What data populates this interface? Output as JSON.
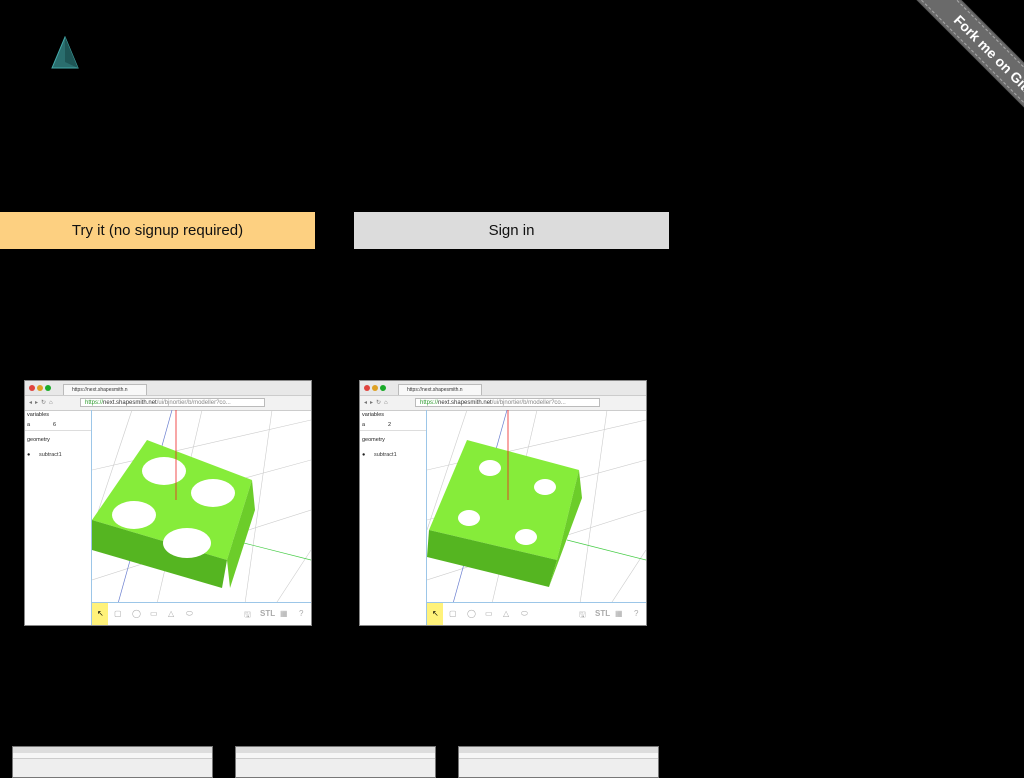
{
  "logo": {
    "icon": "triangle-logo-icon",
    "color": "#2a7d7d"
  },
  "ribbon": {
    "label": "Fork me on GitHub"
  },
  "buttons": {
    "try_label": "Try it (no signup required)",
    "signin_label": "Sign in",
    "try_color": "#fdd081",
    "signin_color": "#dcdcdc"
  },
  "screenshots": [
    {
      "tab_title": "https://next.shapesmith.n",
      "url_prefix": "https://",
      "url_host": "next.shapesmith.net",
      "url_path": "/ui/bjnortier/b/modeller?co...",
      "variables_label": "variables",
      "var_name": "a",
      "var_value": "6",
      "geometry_label": "geometry",
      "geometry_item": "subtract1",
      "toolbar_stl": "STL",
      "toolbar_help": "?"
    },
    {
      "tab_title": "https://next.shapesmith.n",
      "url_prefix": "https://",
      "url_host": "next.shapesmith.net",
      "url_path": "/ui/bjnortier/b/modeller?co...",
      "variables_label": "variables",
      "var_name": "a",
      "var_value": "2",
      "geometry_label": "geometry",
      "geometry_item": "subtract1",
      "toolbar_stl": "STL",
      "toolbar_help": "?"
    }
  ]
}
